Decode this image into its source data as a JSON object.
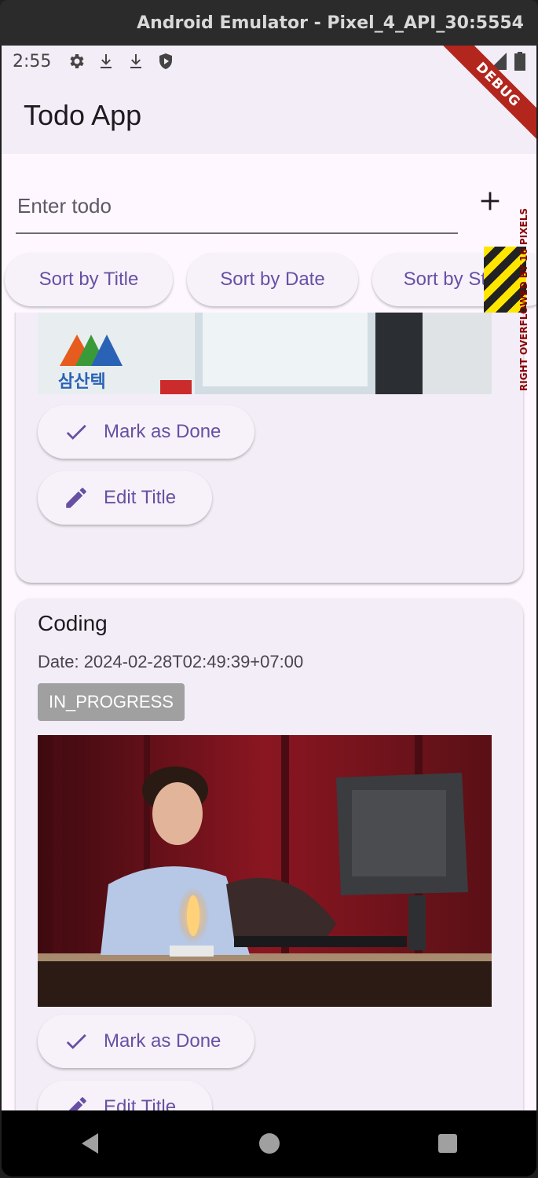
{
  "window": {
    "title": "Android Emulator - Pixel_4_API_30:5554"
  },
  "statusbar": {
    "time": "2:55",
    "icons": [
      "settings-icon",
      "download-icon",
      "download-icon",
      "shield-icon"
    ],
    "right_icons": [
      "wifi-icon",
      "signal-icon",
      "battery-icon"
    ]
  },
  "debug_banner": "DEBUG",
  "appbar": {
    "title": "Todo App"
  },
  "input": {
    "placeholder": "Enter todo",
    "value": ""
  },
  "add_button": {
    "icon": "plus-icon"
  },
  "sort_buttons": [
    "Sort by Title",
    "Sort by Date",
    "Sort by Status"
  ],
  "overflow_warning": "RIGHT OVERFLOWED BY 16 PIXELS",
  "cards": [
    {
      "image_alt": "Samsantech office photo",
      "logo_text": "삼산텍",
      "actions": {
        "done": "Mark as Done",
        "edit": "Edit Title"
      }
    },
    {
      "title": "Coding",
      "date": "Date: 2024-02-28T02:49:39+07:00",
      "status": "IN_PROGRESS",
      "image_alt": "Person coding at a desk",
      "actions": {
        "done": "Mark as Done",
        "edit": "Edit Title"
      }
    }
  ],
  "colors": {
    "primary": "#6750a4",
    "surface": "#fef7ff",
    "card": "#f3edf7",
    "debug": "#b3261e",
    "chip": "#a0a0a0"
  }
}
